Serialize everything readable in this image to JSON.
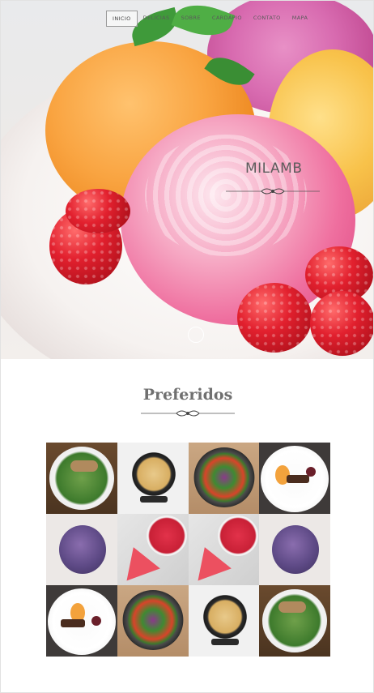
{
  "nav": {
    "items": [
      {
        "label": "INICIO",
        "active": true
      },
      {
        "label": "DELÍCIAS",
        "active": false
      },
      {
        "label": "SOBRE",
        "active": false
      },
      {
        "label": "CARDÁPIO",
        "active": false
      },
      {
        "label": "CONTATO",
        "active": false
      },
      {
        "label": "MAPA",
        "active": false
      }
    ]
  },
  "hero": {
    "brand": "MILAMB",
    "slider_indicator": "slide-dot"
  },
  "preferidos": {
    "title": "Preferidos",
    "tiles": [
      "salad-plate",
      "pasta-pan",
      "vegetable-bowl",
      "dessert-plate",
      "blueberry-donut",
      "watermelon-smoothie",
      "watermelon-smoothie",
      "blueberry-donut",
      "dessert-plate",
      "vegetable-bowl",
      "pasta-pan",
      "salad-plate"
    ]
  },
  "colors": {
    "title_gray": "#707070",
    "nav_text": "#5a5a5a"
  }
}
